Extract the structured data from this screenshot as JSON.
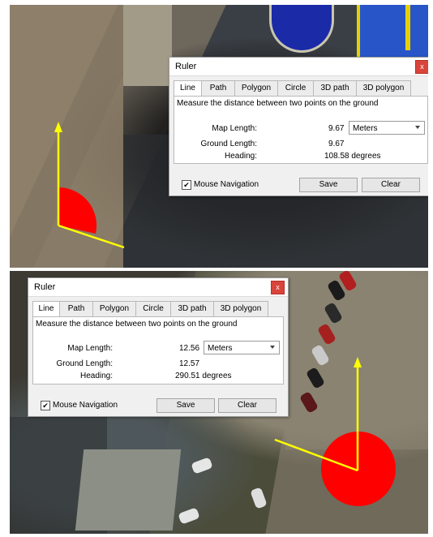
{
  "colors": {
    "marker_red": "#ff0000",
    "marker_yellow": "#ffff00",
    "dialog_bg": "#f0f0f0"
  },
  "dialogs": [
    {
      "title": "Ruler",
      "close_icon": "close-icon",
      "tabs": [
        "Line",
        "Path",
        "Polygon",
        "Circle",
        "3D path",
        "3D polygon"
      ],
      "active_tab": "Line",
      "description": "Measure the distance between two points on the ground",
      "map_length_label": "Map Length:",
      "map_length_value": "9.67",
      "unit": "Meters",
      "ground_length_label": "Ground Length:",
      "ground_length_value": "9.67",
      "heading_label": "Heading:",
      "heading_value": "108.58 degrees",
      "mouse_nav_checked": true,
      "mouse_nav_label": "Mouse Navigation",
      "save_label": "Save",
      "clear_label": "Clear"
    },
    {
      "title": "Ruler",
      "close_icon": "close-icon",
      "tabs": [
        "Line",
        "Path",
        "Polygon",
        "Circle",
        "3D path",
        "3D polygon"
      ],
      "active_tab": "Line",
      "description": "Measure the distance between two points on the ground",
      "map_length_label": "Map Length:",
      "map_length_value": "12.56",
      "unit": "Meters",
      "ground_length_label": "Ground Length:",
      "ground_length_value": "12.57",
      "heading_label": "Heading:",
      "heading_value": "290.51 degrees",
      "mouse_nav_checked": true,
      "mouse_nav_label": "Mouse Navigation",
      "save_label": "Save",
      "clear_label": "Clear"
    }
  ]
}
